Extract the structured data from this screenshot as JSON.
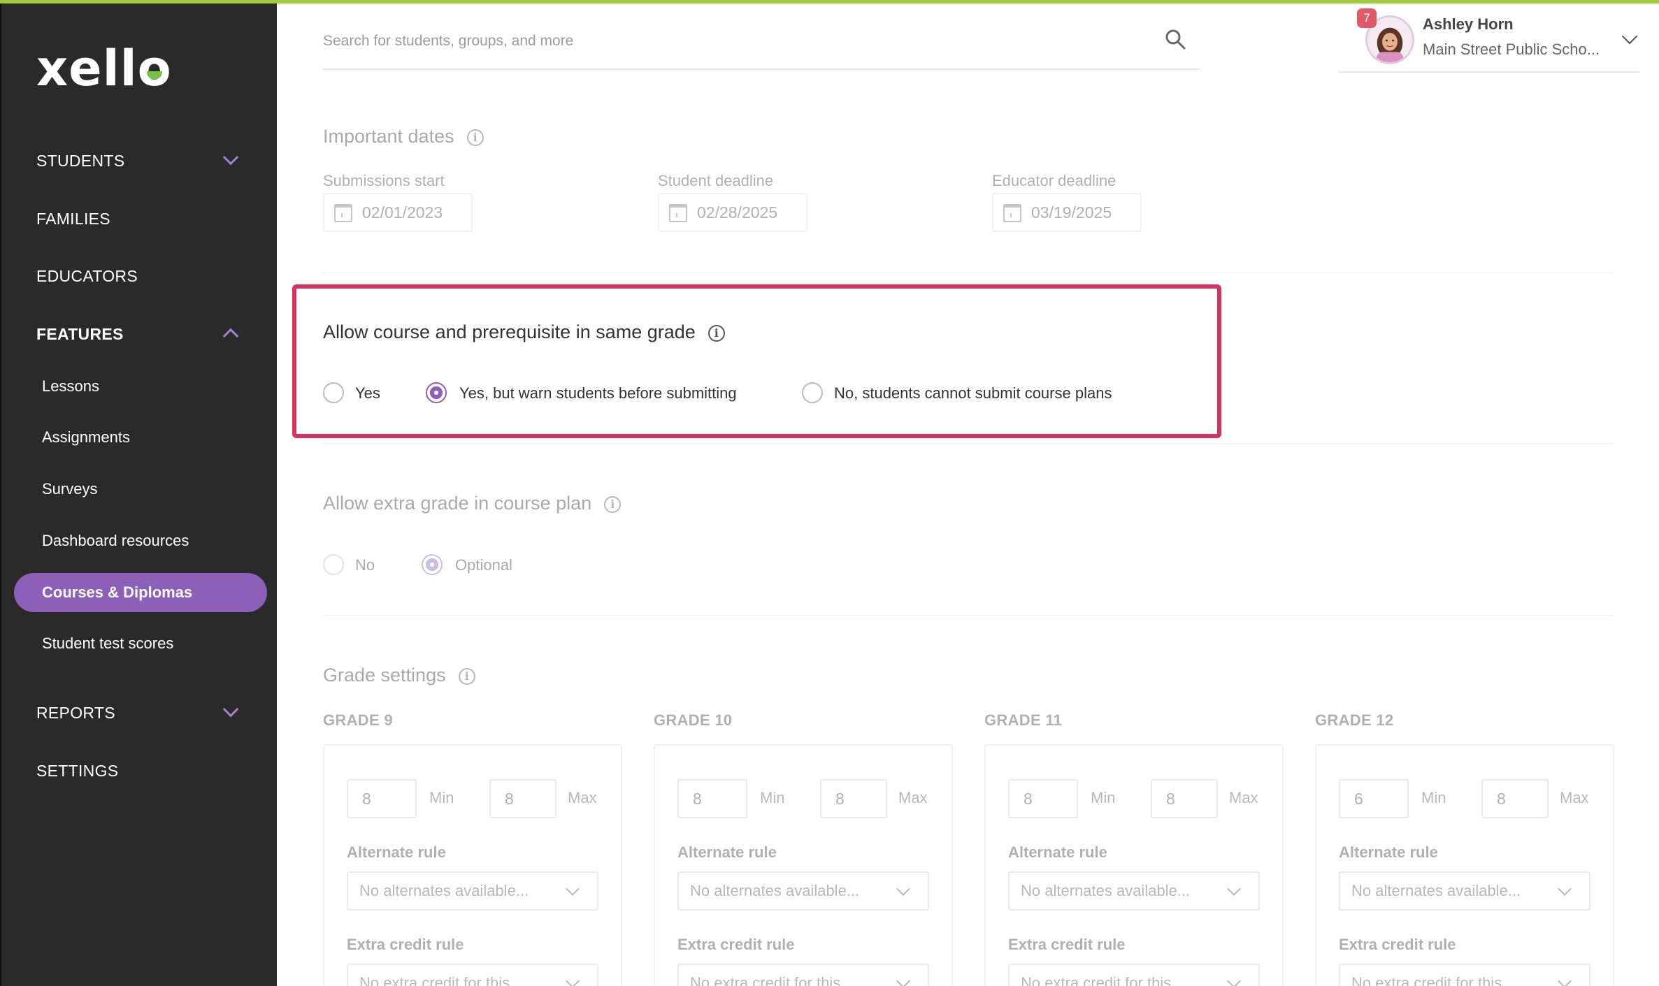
{
  "brand": {
    "logo_text_prefix": "xell",
    "logo_text_o": "o",
    "accent": "#8c5fb8",
    "highlight_color": "#d5345e"
  },
  "sidebar": {
    "students": "STUDENTS",
    "families": "FAMILIES",
    "educators": "EDUCATORS",
    "features": "FEATURES",
    "sub_items": [
      "Lessons",
      "Assignments",
      "Surveys",
      "Dashboard resources",
      "Courses & Diplomas",
      "Student test scores"
    ],
    "active_item": "Courses & Diplomas",
    "reports": "REPORTS",
    "settings": "SETTINGS"
  },
  "header": {
    "search_placeholder": "Search for students, groups, and more",
    "notification_count": "7",
    "user_name": "Ashley Horn",
    "user_school": "Main Street Public Scho..."
  },
  "important_dates": {
    "title": "Important dates",
    "fields": [
      {
        "label": "Submissions start",
        "value": "02/01/2023"
      },
      {
        "label": "Student deadline",
        "value": "02/28/2025"
      },
      {
        "label": "Educator deadline",
        "value": "03/19/2025"
      }
    ]
  },
  "prereq_setting": {
    "title": "Allow course and prerequisite in same grade",
    "options": [
      "Yes",
      "Yes, but warn students before submitting",
      "No, students cannot submit course plans"
    ],
    "selected": "Yes, but warn students before submitting"
  },
  "extra_grade_setting": {
    "title": "Allow extra grade in course plan",
    "options": [
      "No",
      "Optional"
    ],
    "selected": "Optional"
  },
  "grade_settings": {
    "title": "Grade settings",
    "min_label": "Min",
    "max_label": "Max",
    "alternate_rule_label": "Alternate rule",
    "alternate_rule_value": "No alternates available...",
    "extra_credit_label": "Extra credit rule",
    "extra_credit_value": "No extra credit for this...",
    "grades": [
      {
        "name": "GRADE 9",
        "min": "8",
        "max": "8"
      },
      {
        "name": "GRADE 10",
        "min": "8",
        "max": "8"
      },
      {
        "name": "GRADE 11",
        "min": "8",
        "max": "8"
      },
      {
        "name": "GRADE 12",
        "min": "6",
        "max": "8"
      }
    ]
  }
}
